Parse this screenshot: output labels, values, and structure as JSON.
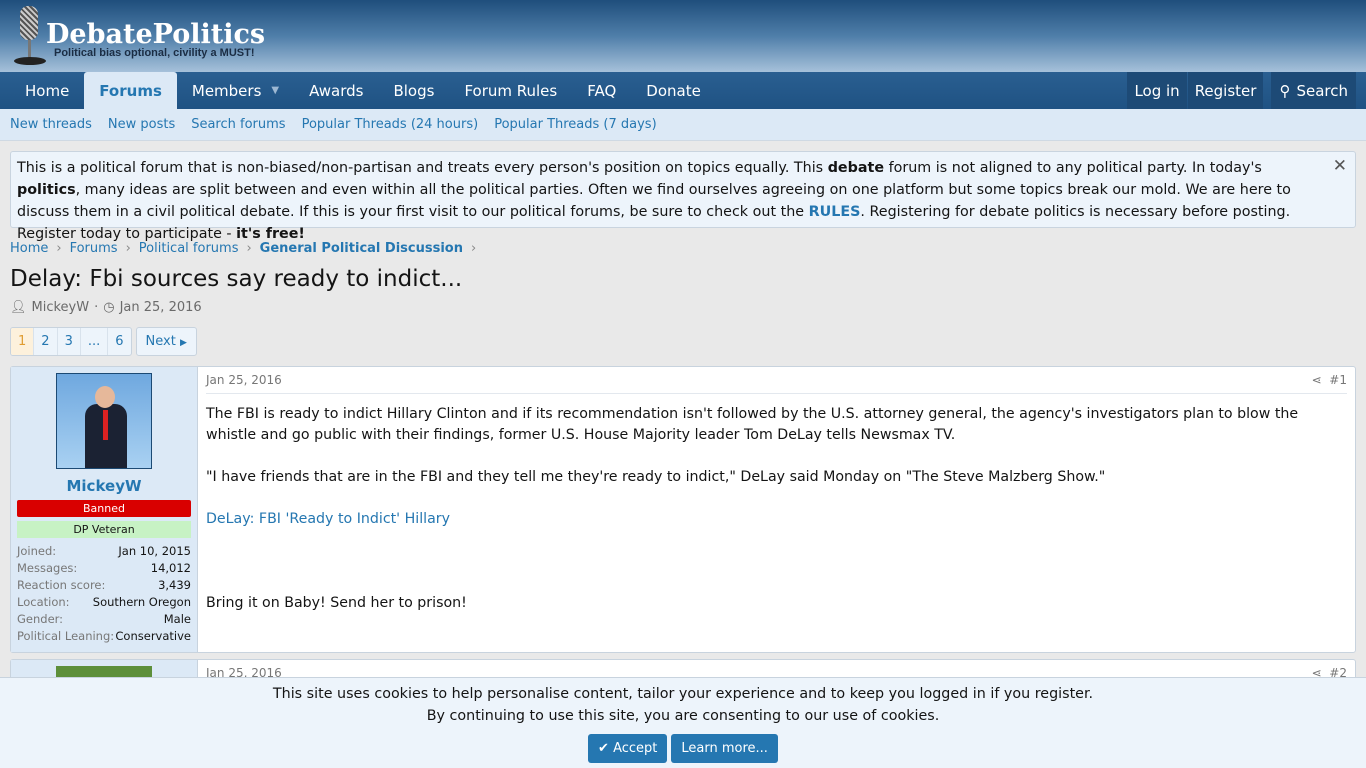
{
  "site": {
    "name": "DebatePolitics",
    "tagline": "Political bias optional, civility a MUST!"
  },
  "nav": {
    "items": [
      "Home",
      "Forums",
      "Members",
      "Awards",
      "Blogs",
      "Forum Rules",
      "FAQ",
      "Donate"
    ],
    "login": "Log in",
    "register": "Register",
    "search": "Search"
  },
  "subnav": [
    "New threads",
    "New posts",
    "Search forums",
    "Popular Threads (24 hours)",
    "Popular Threads (7 days)"
  ],
  "notice": {
    "p1": "This is a political forum that is non-biased/non-partisan and treats every person's position on topics equally. This ",
    "b1": "debate",
    "p2": " forum is not aligned to any political party. In today's ",
    "b2": "politics",
    "p3": ", many ideas are split between and even within all the political parties. Often we find ourselves agreeing on one platform but some topics break our mold. We are here to discuss them in a civil political debate. If this is your first visit to our political forums, be sure to check out the ",
    "rules": "RULES",
    "p4": ". Registering for debate politics is necessary before posting. Register today to participate - ",
    "b3": "it's free!"
  },
  "breadcrumb": [
    "Home",
    "Forums",
    "Political forums",
    "General Political Discussion"
  ],
  "thread": {
    "title": "Delay: Fbi sources say ready to indict...",
    "author": "MickeyW",
    "date": "Jan 25, 2016"
  },
  "pagination": {
    "pages": [
      "1",
      "2",
      "3",
      "...",
      "6"
    ],
    "current": "1",
    "next": "Next"
  },
  "posts": [
    {
      "user": "MickeyW",
      "banner": "Banned",
      "title": "DP Veteran",
      "stats": [
        [
          "Joined:",
          "Jan 10, 2015"
        ],
        [
          "Messages:",
          "14,012"
        ],
        [
          "Reaction score:",
          "3,439"
        ],
        [
          "Location:",
          "Southern Oregon"
        ],
        [
          "Gender:",
          "Male"
        ],
        [
          "Political Leaning:",
          "Conservative"
        ]
      ],
      "date": "Jan 25, 2016",
      "num": "#1",
      "p1": "The FBI is ready to indict Hillary Clinton and if its recommendation isn't followed by the U.S. attorney general, the agency's investigators plan to blow the whistle and go public with their findings, former U.S. House Majority leader Tom DeLay tells Newsmax TV.",
      "p2": "\"I have friends that are in the FBI and they tell me they're ready to indict,\" DeLay said Monday on \"The Steve Malzberg Show.\"",
      "link": "DeLay: FBI 'Ready to Indict' Hillary",
      "p3": "Bring it on Baby! Send her to prison!"
    },
    {
      "date": "Jan 25, 2016",
      "num": "#2"
    }
  ],
  "cookie": {
    "line1": "This site uses cookies to help personalise content, tailor your experience and to keep you logged in if you register.",
    "line2": "By continuing to use this site, you are consenting to our use of cookies.",
    "accept": "Accept",
    "learn": "Learn more..."
  }
}
